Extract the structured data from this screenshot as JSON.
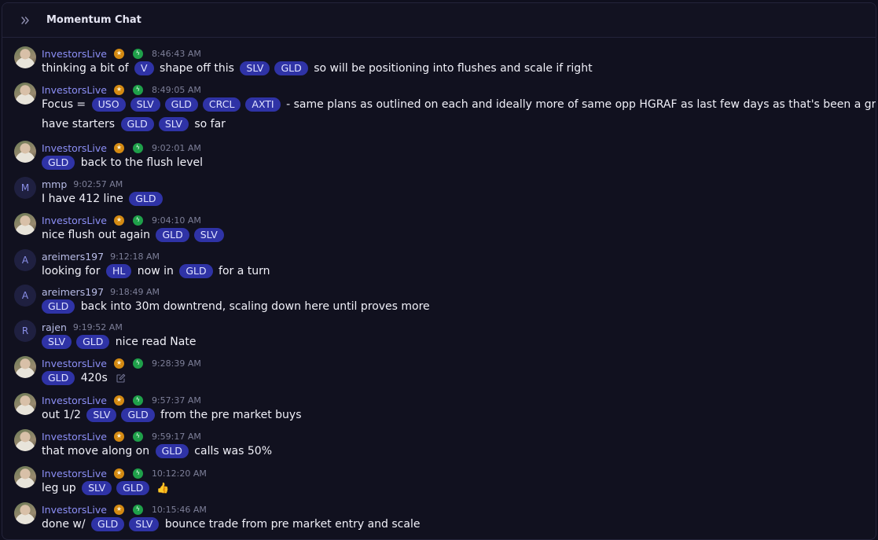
{
  "header": {
    "title": "Momentum Chat",
    "collapse_icon": "chevrons-right-icon"
  },
  "messages": [
    {
      "user": "InvestorsLive",
      "time": "8:46:43 AM",
      "lines": [
        [
          {
            "t": "text",
            "v": "thinking a bit of "
          },
          {
            "t": "tag",
            "v": "V"
          },
          {
            "t": "text",
            "v": " shape off this "
          },
          {
            "t": "tag",
            "v": "SLV"
          },
          {
            "t": "tag",
            "v": "GLD"
          },
          {
            "t": "text",
            "v": " so will be positioning into flushes and scale if right"
          }
        ]
      ]
    },
    {
      "user": "InvestorsLive",
      "time": "8:49:05 AM",
      "lines": [
        [
          {
            "t": "text",
            "v": "Focus = "
          },
          {
            "t": "tag",
            "v": "USO"
          },
          {
            "t": "tag",
            "v": "SLV"
          },
          {
            "t": "tag",
            "v": "GLD"
          },
          {
            "t": "tag",
            "v": "CRCL"
          },
          {
            "t": "tag",
            "v": "AXTI"
          },
          {
            "t": "text",
            "v": " - same plans as outlined on each and ideally more of same opp HGRAF as last few days as that's been a great one"
          }
        ],
        [
          {
            "t": "text",
            "v": "have starters "
          },
          {
            "t": "tag",
            "v": "GLD"
          },
          {
            "t": "tag",
            "v": "SLV"
          },
          {
            "t": "text",
            "v": " so far"
          }
        ]
      ]
    },
    {
      "user": "InvestorsLive",
      "time": "9:02:01 AM",
      "lines": [
        [
          {
            "t": "tag",
            "v": "GLD"
          },
          {
            "t": "text",
            "v": " back to the flush level"
          }
        ]
      ]
    },
    {
      "user": "mmp",
      "letter": "M",
      "time": "9:02:57 AM",
      "lines": [
        [
          {
            "t": "text",
            "v": "I have 412 line "
          },
          {
            "t": "tag",
            "v": "GLD"
          }
        ]
      ]
    },
    {
      "user": "InvestorsLive",
      "time": "9:04:10 AM",
      "lines": [
        [
          {
            "t": "text",
            "v": "nice flush out again "
          },
          {
            "t": "tag",
            "v": "GLD"
          },
          {
            "t": "tag",
            "v": "SLV"
          }
        ]
      ]
    },
    {
      "user": "areimers197",
      "letter": "A",
      "time": "9:12:18 AM",
      "lines": [
        [
          {
            "t": "text",
            "v": "looking for "
          },
          {
            "t": "tag",
            "v": "HL"
          },
          {
            "t": "text",
            "v": " now in "
          },
          {
            "t": "tag",
            "v": "GLD"
          },
          {
            "t": "text",
            "v": " for a turn"
          }
        ]
      ]
    },
    {
      "user": "areimers197",
      "letter": "A",
      "time": "9:18:49 AM",
      "lines": [
        [
          {
            "t": "tag",
            "v": "GLD"
          },
          {
            "t": "text",
            "v": " back into 30m downtrend, scaling down here until proves more"
          }
        ]
      ]
    },
    {
      "user": "rajen",
      "letter": "R",
      "time": "9:19:52 AM",
      "lines": [
        [
          {
            "t": "tag",
            "v": "SLV"
          },
          {
            "t": "tag",
            "v": "GLD"
          },
          {
            "t": "text",
            "v": " nice read Nate"
          }
        ]
      ]
    },
    {
      "user": "InvestorsLive",
      "time": "9:28:39 AM",
      "edited": true,
      "lines": [
        [
          {
            "t": "tag",
            "v": "GLD"
          },
          {
            "t": "text",
            "v": " 420s"
          }
        ]
      ]
    },
    {
      "user": "InvestorsLive",
      "time": "9:57:37 AM",
      "lines": [
        [
          {
            "t": "text",
            "v": "out 1/2 "
          },
          {
            "t": "tag",
            "v": "SLV"
          },
          {
            "t": "tag",
            "v": "GLD"
          },
          {
            "t": "text",
            "v": " from the pre market buys"
          }
        ]
      ]
    },
    {
      "user": "InvestorsLive",
      "time": "9:59:17 AM",
      "lines": [
        [
          {
            "t": "text",
            "v": "that move along on "
          },
          {
            "t": "tag",
            "v": "GLD"
          },
          {
            "t": "text",
            "v": " calls was 50%"
          }
        ]
      ]
    },
    {
      "user": "InvestorsLive",
      "time": "10:12:20 AM",
      "lines": [
        [
          {
            "t": "text",
            "v": "leg up "
          },
          {
            "t": "tag",
            "v": "SLV"
          },
          {
            "t": "tag",
            "v": "GLD"
          },
          {
            "t": "emoji",
            "v": "👍"
          }
        ]
      ]
    },
    {
      "user": "InvestorsLive",
      "time": "10:15:46 AM",
      "lines": [
        [
          {
            "t": "text",
            "v": "done w/ "
          },
          {
            "t": "tag",
            "v": "GLD"
          },
          {
            "t": "tag",
            "v": "SLV"
          },
          {
            "t": "text",
            "v": " bounce trade from pre market entry and scale"
          }
        ]
      ]
    }
  ]
}
